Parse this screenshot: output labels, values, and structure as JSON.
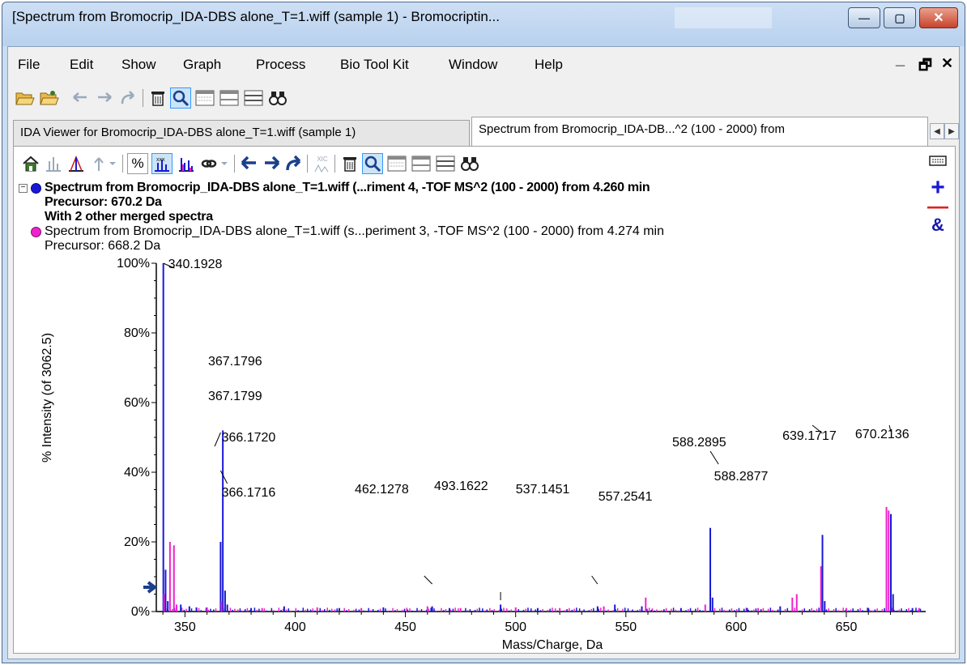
{
  "window": {
    "title": "[Spectrum from Bromocrip_IDA-DBS alone_T=1.wiff (sample 1) - Bromocriptin...",
    "minimize_label": "—",
    "maximize_label": "▢",
    "close_label": "✕"
  },
  "menu": {
    "items": [
      "File",
      "Edit",
      "Show",
      "Graph",
      "Process",
      "Bio Tool Kit",
      "Window",
      "Help"
    ],
    "mdi_minimize": "_",
    "mdi_restore": "🗗",
    "mdi_close": "✕"
  },
  "tabs": [
    {
      "label": "IDA Viewer for Bromocrip_IDA-DBS alone_T=1.wiff (sample 1)",
      "active": false
    },
    {
      "label": "Spectrum from Bromocrip_IDA-DB...^2 (100 - 2000) from",
      "active": true
    }
  ],
  "spectrum_toolbar": {
    "percent_label": "%",
    "xic_label": "XIC"
  },
  "side_buttons": {
    "add": "+",
    "remove": "—",
    "and": "&"
  },
  "legend": {
    "primary": {
      "title": "Spectrum from Bromocrip_IDA-DBS alone_T=1.wiff (...riment 4, -TOF MS^2 (100 - 2000) from 4.260 min",
      "precursor": "Precursor: 670.2 Da",
      "merged": "With 2 other merged spectra",
      "color": "#1818d8"
    },
    "secondary": {
      "title": "Spectrum from Bromocrip_IDA-DBS alone_T=1.wiff (s...periment 3, -TOF MS^2 (100 - 2000) from 4.274 min",
      "precursor": "Precursor: 668.2 Da",
      "color": "#ee22cc"
    }
  },
  "chart_data": {
    "type": "bar",
    "xlabel": "Mass/Charge, Da",
    "ylabel": "% Intensity (of 3062.5)",
    "xlim": [
      337,
      686
    ],
    "ylim": [
      0,
      100
    ],
    "x_ticks": [
      350,
      400,
      450,
      500,
      550,
      600,
      650
    ],
    "y_ticks": [
      {
        "value": 0,
        "label": "0%"
      },
      {
        "value": 20,
        "label": "20%"
      },
      {
        "value": 40,
        "label": "40%"
      },
      {
        "value": 60,
        "label": "60%"
      },
      {
        "value": 80,
        "label": "80%"
      },
      {
        "value": 100,
        "label": "100%"
      }
    ],
    "series": [
      {
        "name": "Spectrum from Bromocrip_IDA-DBS alone_T=1.wiff (...riment 4, -TOF MS^2 (100 - 2000) from 4.260 min",
        "color": "#1818d8",
        "points": [
          {
            "x": 340.19,
            "y": 100
          },
          {
            "x": 341.2,
            "y": 12
          },
          {
            "x": 342.2,
            "y": 3
          },
          {
            "x": 348.1,
            "y": 2
          },
          {
            "x": 352.0,
            "y": 1.5
          },
          {
            "x": 355.2,
            "y": 1.2
          },
          {
            "x": 366.17,
            "y": 20
          },
          {
            "x": 367.18,
            "y": 52
          },
          {
            "x": 368.2,
            "y": 6
          },
          {
            "x": 369.2,
            "y": 2
          },
          {
            "x": 380.0,
            "y": 1
          },
          {
            "x": 395.0,
            "y": 1.5
          },
          {
            "x": 420.0,
            "y": 1
          },
          {
            "x": 440.0,
            "y": 1.2
          },
          {
            "x": 462.13,
            "y": 1.5
          },
          {
            "x": 470.0,
            "y": 1
          },
          {
            "x": 493.16,
            "y": 2
          },
          {
            "x": 510.0,
            "y": 1
          },
          {
            "x": 537.15,
            "y": 1.5
          },
          {
            "x": 545.0,
            "y": 2
          },
          {
            "x": 557.25,
            "y": 1.5
          },
          {
            "x": 575.0,
            "y": 1
          },
          {
            "x": 588.29,
            "y": 24
          },
          {
            "x": 589.3,
            "y": 4
          },
          {
            "x": 605.0,
            "y": 1
          },
          {
            "x": 620.0,
            "y": 1.5
          },
          {
            "x": 639.17,
            "y": 22
          },
          {
            "x": 640.2,
            "y": 3
          },
          {
            "x": 660.0,
            "y": 1
          },
          {
            "x": 670.21,
            "y": 28
          },
          {
            "x": 671.2,
            "y": 5
          },
          {
            "x": 680.0,
            "y": 1
          }
        ]
      },
      {
        "name": "Spectrum from Bromocrip_IDA-DBS alone_T=1.wiff (s...periment 3, -TOF MS^2 (100 - 2000) from 4.274 min",
        "color": "#ee22cc",
        "points": [
          {
            "x": 340.5,
            "y": 5
          },
          {
            "x": 343.2,
            "y": 20
          },
          {
            "x": 345.0,
            "y": 19
          },
          {
            "x": 346.2,
            "y": 2
          },
          {
            "x": 360.0,
            "y": 1.2
          },
          {
            "x": 366.6,
            "y": 3
          },
          {
            "x": 385.0,
            "y": 1
          },
          {
            "x": 410.0,
            "y": 1.2
          },
          {
            "x": 430.0,
            "y": 1
          },
          {
            "x": 460.0,
            "y": 1.5
          },
          {
            "x": 475.0,
            "y": 1
          },
          {
            "x": 500.0,
            "y": 1.2
          },
          {
            "x": 520.0,
            "y": 1
          },
          {
            "x": 540.0,
            "y": 1.5
          },
          {
            "x": 559.0,
            "y": 4
          },
          {
            "x": 586.0,
            "y": 2
          },
          {
            "x": 610.0,
            "y": 1
          },
          {
            "x": 625.5,
            "y": 4
          },
          {
            "x": 627.5,
            "y": 5
          },
          {
            "x": 638.5,
            "y": 13
          },
          {
            "x": 650.0,
            "y": 1
          },
          {
            "x": 668.2,
            "y": 30
          },
          {
            "x": 669.2,
            "y": 29
          },
          {
            "x": 683.0,
            "y": 1
          }
        ]
      }
    ],
    "annotations": [
      {
        "label": "340.1928",
        "x": 340.19,
        "y": 100
      },
      {
        "label": "367.1796",
        "x": 367.18,
        "y": 52
      },
      {
        "label": "367.1799",
        "x": 367.18,
        "y": 40
      },
      {
        "label": "366.1720",
        "x": 366.17,
        "y": 20
      },
      {
        "label": "366.1716",
        "x": 366.17,
        "y": 11
      },
      {
        "label": "462.1278",
        "x": 462.13,
        "y": 1.5
      },
      {
        "label": "493.1622",
        "x": 493.16,
        "y": 2
      },
      {
        "label": "537.1451",
        "x": 537.15,
        "y": 1.5
      },
      {
        "label": "557.2541",
        "x": 557.25,
        "y": 1.5
      },
      {
        "label": "588.2895",
        "x": 588.29,
        "y": 24
      },
      {
        "label": "588.2877",
        "x": 588.29,
        "y": 13
      },
      {
        "label": "639.1717",
        "x": 639.17,
        "y": 22
      },
      {
        "label": "670.2136",
        "x": 670.21,
        "y": 28
      }
    ]
  }
}
